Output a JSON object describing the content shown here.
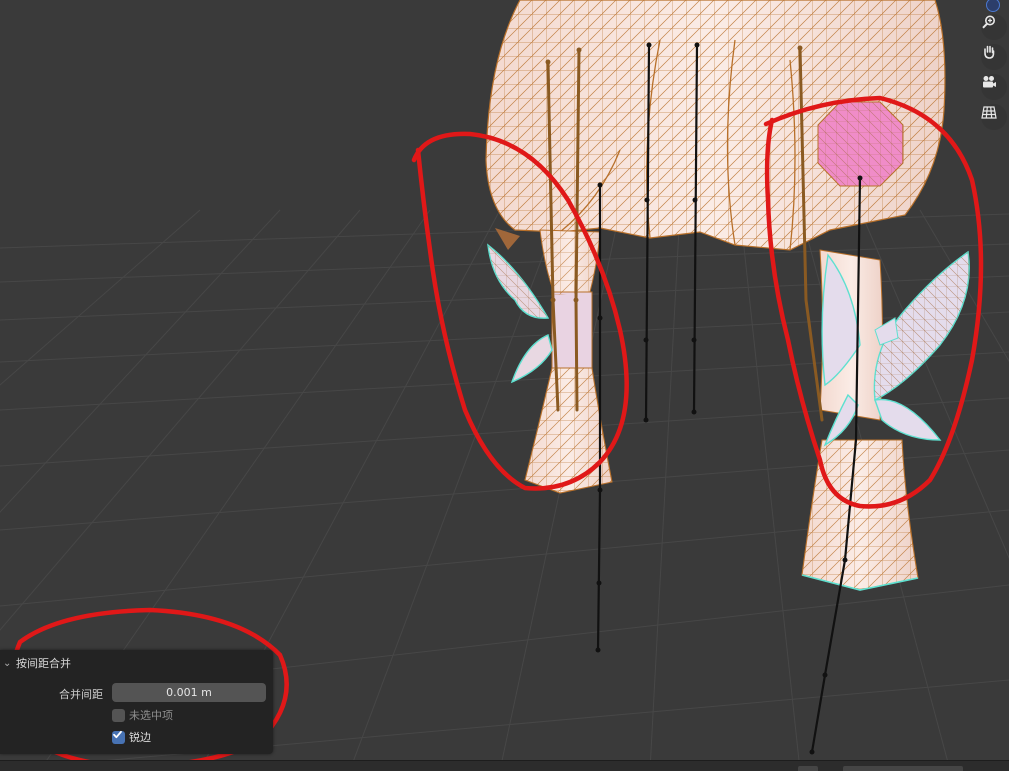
{
  "redo_panel": {
    "title": "按间距合并",
    "merge_distance_label": "合并间距",
    "merge_distance_value": "0.001 m",
    "unselected_label": "未选中项",
    "unselected_checked": false,
    "sharp_edges_label": "锐边",
    "sharp_edges_checked": true
  },
  "navigation": {
    "icons": [
      "zoom-icon",
      "hand-pan-icon",
      "camera-icon",
      "grid-ortho-icon"
    ]
  },
  "colors": {
    "viewport_bg": "#3a3a3a",
    "grid_line": "#474747",
    "mesh_fill": "#f6e2dc",
    "mesh_wire": "#b8702a",
    "selection_outline": "#5ee0d0",
    "bone": "#111111",
    "highlight_face": "#f08cc8",
    "annotation": "#e01818",
    "checkbox_on": "#4772b3"
  }
}
